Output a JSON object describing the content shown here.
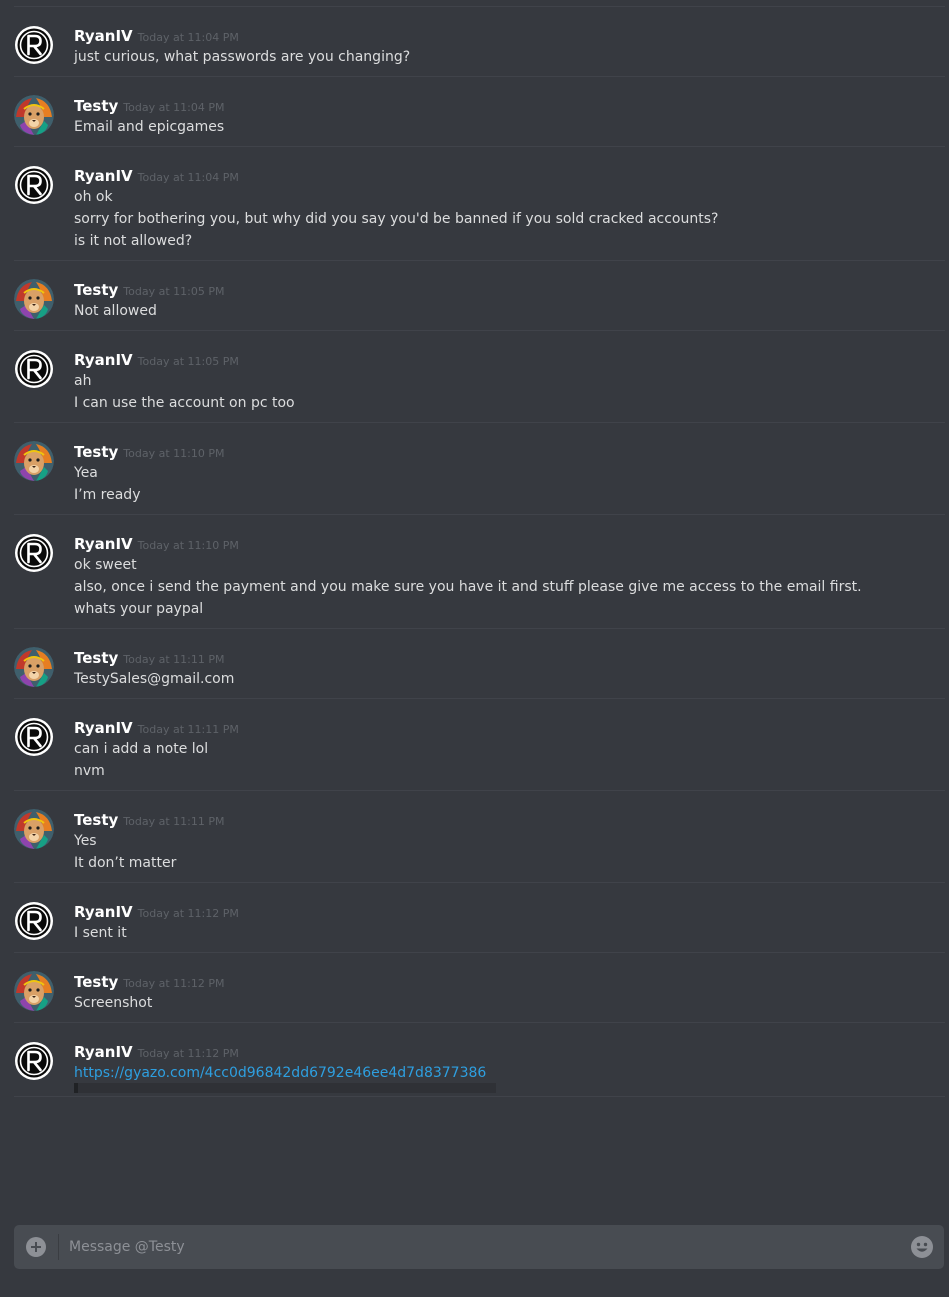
{
  "messages": [
    {
      "user": "RyanIV",
      "avatar": "ryan",
      "time": "Today at 11:04 PM",
      "lines": [
        "just curious, what passwords are you changing?"
      ]
    },
    {
      "user": "Testy",
      "avatar": "lion",
      "time": "Today at 11:04 PM",
      "lines": [
        "Email and epicgames"
      ]
    },
    {
      "user": "RyanIV",
      "avatar": "ryan",
      "time": "Today at 11:04 PM",
      "lines": [
        "oh ok",
        "sorry for bothering you, but why did you say you'd be banned if you sold cracked accounts?",
        "is it not allowed?"
      ]
    },
    {
      "user": "Testy",
      "avatar": "lion",
      "time": "Today at 11:05 PM",
      "lines": [
        "Not allowed"
      ]
    },
    {
      "user": "RyanIV",
      "avatar": "ryan",
      "time": "Today at 11:05 PM",
      "lines": [
        "ah",
        "I can use the account on pc too"
      ]
    },
    {
      "user": "Testy",
      "avatar": "lion",
      "time": "Today at 11:10 PM",
      "lines": [
        "Yea",
        "I’m ready"
      ]
    },
    {
      "user": "RyanIV",
      "avatar": "ryan",
      "time": "Today at 11:10 PM",
      "lines": [
        "ok sweet",
        "also, once i send the payment and you make sure you have it and stuff please give me access to the email first.",
        "whats your paypal"
      ]
    },
    {
      "user": "Testy",
      "avatar": "lion",
      "time": "Today at 11:11 PM",
      "lines": [
        "TestySales@gmail.com"
      ]
    },
    {
      "user": "RyanIV",
      "avatar": "ryan",
      "time": "Today at 11:11 PM",
      "lines": [
        "can i add a note lol",
        "nvm"
      ]
    },
    {
      "user": "Testy",
      "avatar": "lion",
      "time": "Today at 11:11 PM",
      "lines": [
        "Yes",
        "It don’t matter"
      ]
    },
    {
      "user": "RyanIV",
      "avatar": "ryan",
      "time": "Today at 11:12 PM",
      "lines": [
        "I sent it"
      ]
    },
    {
      "user": "Testy",
      "avatar": "lion",
      "time": "Today at 11:12 PM",
      "lines": [
        "Screenshot"
      ]
    },
    {
      "user": "RyanIV",
      "avatar": "ryan",
      "time": "Today at 11:12 PM",
      "lines": [],
      "link": "https://gyazo.com/4cc0d96842dd6792e46ee4d7d8377386",
      "embed": true
    }
  ],
  "composer": {
    "placeholder": "Message @Testy",
    "attach_icon": "plus-circle-icon",
    "emoji_icon": "smiley-icon"
  },
  "colors": {
    "background": "#36393f",
    "username": "#ffffff",
    "timestamp": "#5e6268",
    "text": "#dcddde",
    "link": "#2e9fe0",
    "composer": "#484c52"
  }
}
